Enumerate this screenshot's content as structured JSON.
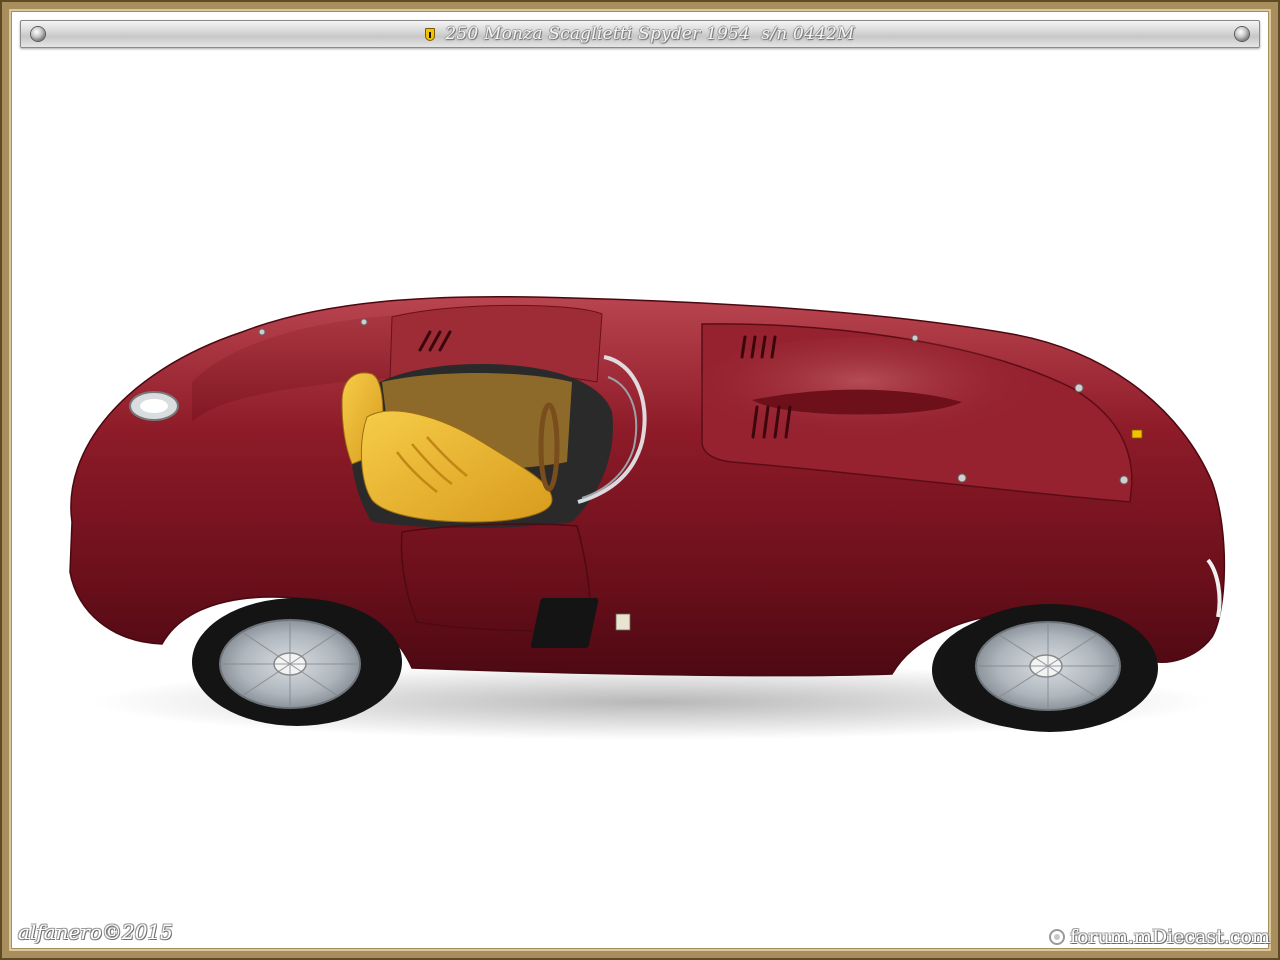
{
  "header": {
    "title": "250 Monza Scaglietti Spyder 1954  s/n 0442M"
  },
  "watermarks": {
    "signature": "alfanero©2015",
    "forum": "forum.mDiecast.com"
  },
  "icons": {
    "badge": "ferrari-shield-icon",
    "rivets": "rivet-icon",
    "forum_logo": "forum-logo-icon"
  },
  "colors": {
    "frame": "#a88e5c",
    "car_body": "#8e1b28",
    "seat": "#e8b830",
    "background": "#ffffff"
  }
}
